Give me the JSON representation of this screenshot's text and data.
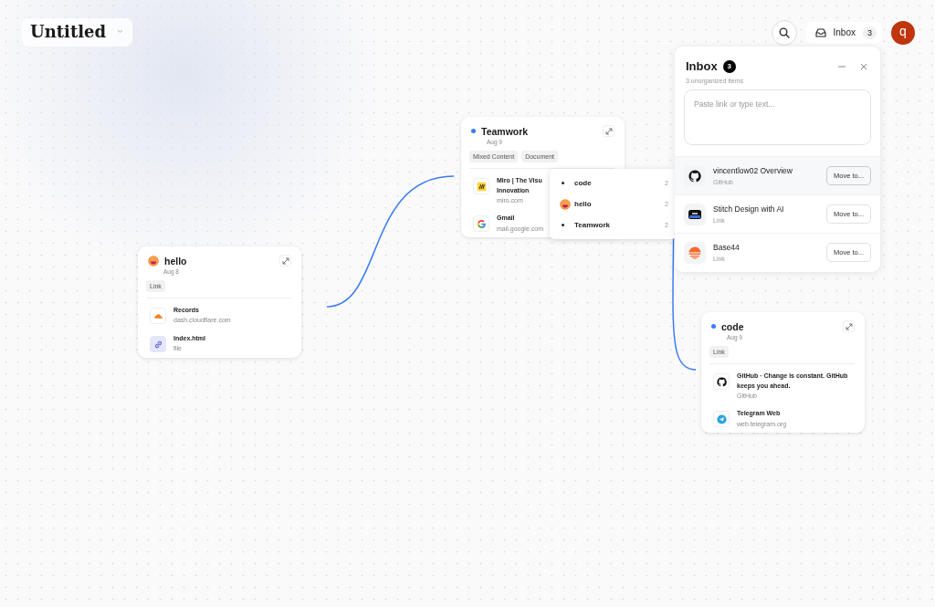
{
  "document": {
    "title": "Untitled"
  },
  "toolbar": {
    "inbox_label": "Inbox",
    "inbox_count": "3",
    "avatar": "q"
  },
  "inbox_panel": {
    "title": "Inbox",
    "count": "3",
    "subtitle": "3 unorganized items",
    "placeholder": "Paste link or type text...",
    "items": [
      {
        "title": "vincentlow02 Overview",
        "source": "GitHub",
        "button": "Move to...",
        "selected": true
      },
      {
        "title": "Stitch Design with AI",
        "source": "Link",
        "button": "Move to...",
        "selected": false
      },
      {
        "title": "Base44",
        "source": "Link",
        "button": "Move to...",
        "selected": false
      }
    ]
  },
  "cards": [
    {
      "title": "hello",
      "date": "Aug 8",
      "kind": "emoji",
      "tags": [
        "Link"
      ],
      "items": [
        {
          "lines": [
            "Records"
          ],
          "subtitle": "dash.cloudflare.com"
        },
        {
          "lines": [
            "Index.html"
          ],
          "subtitle": "file"
        }
      ]
    },
    {
      "title": "Teamwork",
      "date": "Aug 9",
      "kind": "dot",
      "tags": [
        "Mixed Content",
        "Document"
      ],
      "items": [
        {
          "lines": [
            "Miro | The Visu",
            "Innovation"
          ],
          "subtitle": "miro.com"
        },
        {
          "lines": [
            "Gmail"
          ],
          "subtitle": "mail.google.com"
        }
      ]
    },
    {
      "title": "code",
      "date": "Aug 9",
      "kind": "dot",
      "tags": [
        "Link"
      ],
      "items": [
        {
          "lines": [
            "GitHub · Change is constant. GitHub",
            "keeps you ahead."
          ],
          "subtitle": "GitHub"
        },
        {
          "lines": [
            "Telegram Web"
          ],
          "subtitle": "web.telegram.org"
        }
      ]
    }
  ],
  "move_menu": {
    "items": [
      {
        "label": "code",
        "count": "2",
        "kind": "dot"
      },
      {
        "label": "hello",
        "count": "2",
        "kind": "emoji"
      },
      {
        "label": "Teamwork",
        "count": "2",
        "kind": "dot"
      }
    ]
  }
}
